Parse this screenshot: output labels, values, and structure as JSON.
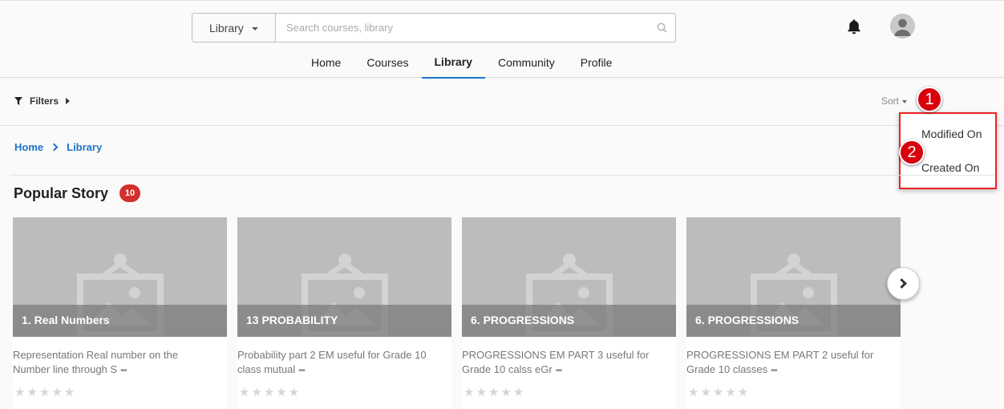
{
  "search": {
    "scope_label": "Library",
    "placeholder": "Search courses, library",
    "value": ""
  },
  "header": {
    "icons": [
      "bell-icon",
      "avatar-icon"
    ]
  },
  "nav": {
    "items": [
      {
        "label": "Home",
        "active": false
      },
      {
        "label": "Courses",
        "active": false
      },
      {
        "label": "Library",
        "active": true
      },
      {
        "label": "Community",
        "active": false
      },
      {
        "label": "Profile",
        "active": false
      }
    ]
  },
  "filterbar": {
    "filters_label": "Filters",
    "sort_label": "Sort"
  },
  "sort_menu": {
    "options": [
      "Modified On",
      "Created On"
    ]
  },
  "markers": [
    "1",
    "2"
  ],
  "breadcrumb": {
    "items": [
      "Home",
      "Library"
    ]
  },
  "section": {
    "title": "Popular Story",
    "count": "10"
  },
  "cards": [
    {
      "title": "1. Real Numbers",
      "desc": "Representation Real number on the Number line through S",
      "rating": 0
    },
    {
      "title": "13 PROBABILITY",
      "desc": "Probability part 2 EM useful for Grade 10 class mutual",
      "rating": 0
    },
    {
      "title": "6. PROGRESSIONS",
      "desc": "PROGRESSIONS EM PART 3 useful for Grade 10 calss eGr",
      "rating": 0
    },
    {
      "title": "6. PROGRESSIONS",
      "desc": "PROGRESSIONS EM PART 2 useful for Grade 10 classes",
      "rating": 0
    }
  ],
  "colors": {
    "accent": "#1f73c7",
    "badge": "#d32f2f",
    "marker": "#d8000c",
    "thumb": "#bcbcbd"
  }
}
